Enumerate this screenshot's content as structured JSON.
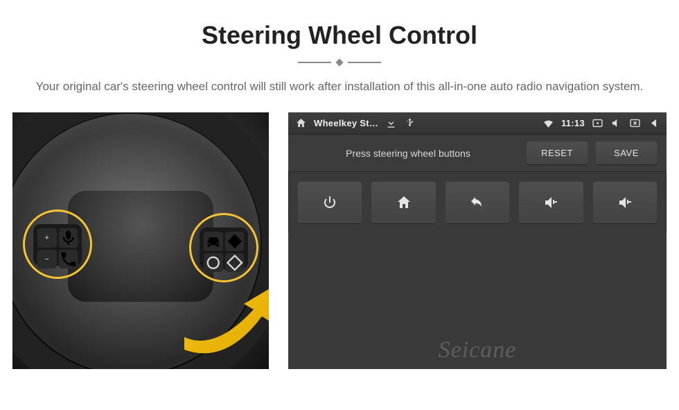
{
  "heading": "Steering Wheel Control",
  "subheading": "Your original car's steering wheel control will still work after installation of this all-in-one auto radio navigation system.",
  "wheel": {
    "left_pad": {
      "tl": "+",
      "tr": "voice-icon",
      "bl": "−",
      "br": "phone-icon"
    },
    "right_pad": {
      "tl": "car-icon",
      "tr": "diamond-icon",
      "bl": "circle-icon",
      "br": "diamond-outline-icon"
    }
  },
  "screen": {
    "status": {
      "app_name": "Wheelkey St…",
      "time": "11:13"
    },
    "toolbar": {
      "hint": "Press steering wheel buttons",
      "reset": "RESET",
      "save": "SAVE"
    },
    "icons": [
      "power-icon",
      "home-icon",
      "back-icon",
      "volume-up-icon",
      "volume-up-icon"
    ],
    "watermark": "Seicane"
  }
}
